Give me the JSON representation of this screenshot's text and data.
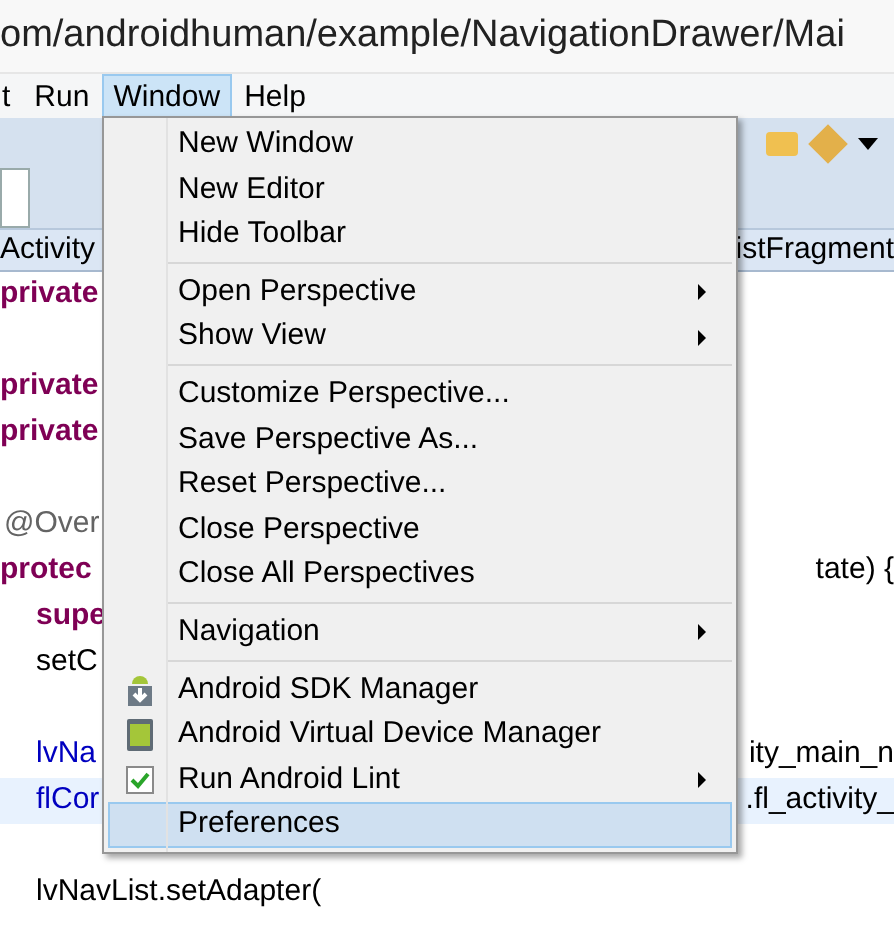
{
  "window": {
    "title": "om/androidhuman/example/NavigationDrawer/Mai"
  },
  "menubar": [
    {
      "label": "t",
      "selected": false
    },
    {
      "label": "Run",
      "selected": false
    },
    {
      "label": "Window",
      "selected": true
    },
    {
      "label": "Help",
      "selected": false
    }
  ],
  "editor_tabs": [
    {
      "label": "Activity"
    },
    {
      "label": "istFragment"
    }
  ],
  "code_lines": [
    {
      "left": "private",
      "kind": "keyword",
      "highlighted": false
    },
    {
      "kind": "blank",
      "highlighted": false
    },
    {
      "left": "private",
      "kind": "keyword",
      "highlighted": false
    },
    {
      "left": "private",
      "kind": "keyword",
      "highlighted": false
    },
    {
      "kind": "blank",
      "highlighted": false
    },
    {
      "left": "@Over",
      "kind": "annotation",
      "highlighted": false
    },
    {
      "left": "protec",
      "right": "tate) {",
      "kind": "keyword",
      "highlighted": false
    },
    {
      "left": "supe",
      "kind": "keyword-indented",
      "highlighted": false
    },
    {
      "left": "setC",
      "kind": "indented",
      "highlighted": false
    },
    {
      "kind": "blank",
      "highlighted": false
    },
    {
      "left": "lvNa",
      "right": "ity_main_n",
      "kind": "field",
      "highlighted": false
    },
    {
      "left": "flCor",
      "right": ".fl_activity_",
      "kind": "field",
      "highlighted": true
    },
    {
      "kind": "blank",
      "highlighted": false
    },
    {
      "left": "lvNavList.setAdapter(",
      "kind": "plain-indented",
      "highlighted": false
    }
  ],
  "menu": [
    {
      "kind": "item",
      "label": "New Window",
      "submenu": false,
      "selected": false
    },
    {
      "kind": "item",
      "label": "New Editor",
      "submenu": false,
      "selected": false
    },
    {
      "kind": "item",
      "label": "Hide Toolbar",
      "submenu": false,
      "selected": false
    },
    {
      "kind": "separator"
    },
    {
      "kind": "item",
      "label": "Open Perspective",
      "submenu": true,
      "selected": false
    },
    {
      "kind": "item",
      "label": "Show View",
      "submenu": true,
      "selected": false
    },
    {
      "kind": "separator"
    },
    {
      "kind": "item",
      "label": "Customize Perspective...",
      "submenu": false,
      "selected": false
    },
    {
      "kind": "item",
      "label": "Save Perspective As...",
      "submenu": false,
      "selected": false
    },
    {
      "kind": "item",
      "label": "Reset Perspective...",
      "submenu": false,
      "selected": false
    },
    {
      "kind": "item",
      "label": "Close Perspective",
      "submenu": false,
      "selected": false
    },
    {
      "kind": "item",
      "label": "Close All Perspectives",
      "submenu": false,
      "selected": false
    },
    {
      "kind": "separator"
    },
    {
      "kind": "item",
      "label": "Navigation",
      "submenu": true,
      "selected": false
    },
    {
      "kind": "separator"
    },
    {
      "kind": "sdk-item",
      "label": "Android SDK Manager",
      "submenu": false,
      "selected": false
    },
    {
      "kind": "device-item",
      "label": "Android Virtual Device Manager",
      "submenu": false,
      "selected": false
    },
    {
      "kind": "check-item",
      "label": "Run Android Lint",
      "submenu": true,
      "selected": false
    },
    {
      "kind": "item",
      "label": "Preferences",
      "submenu": false,
      "selected": true
    }
  ]
}
